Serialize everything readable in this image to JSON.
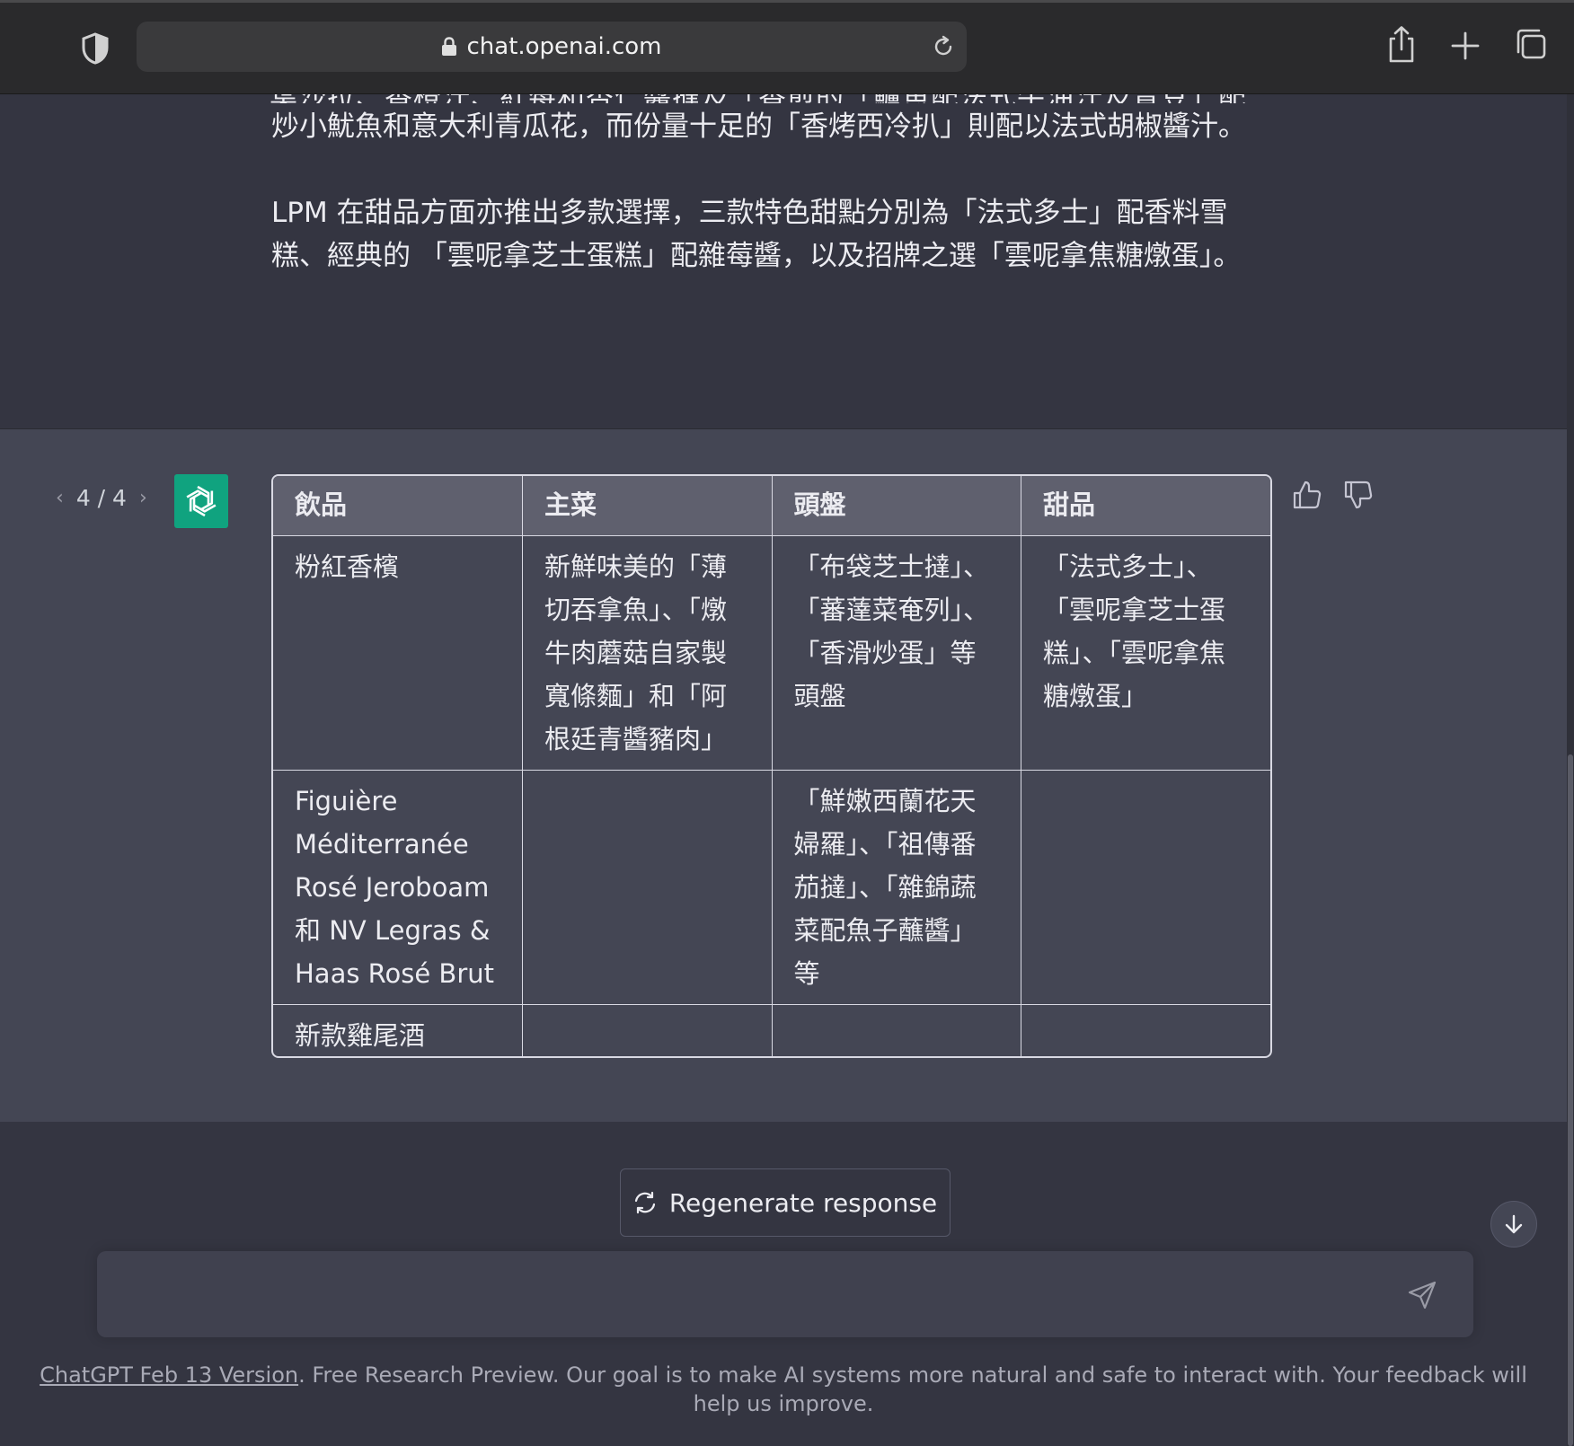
{
  "browser": {
    "url": "chat.openai.com"
  },
  "user_message": {
    "cut_line": "葉沙拉、香橙汁、紅莓和杏仁醬撻及「香煎的「鱸魚配法式牛油汁及青豆」配香蒜",
    "paragraphs": [
      "炒小魷魚和意大利青瓜花，而份量十足的「香烤西冷扒」則配以法式胡椒醬汁。",
      "LPM 在甜品方面亦推出多款選擇，三款特色甜點分別為「法式多士」配香料雪糕、經典的 「雲呢拿芝士蛋糕」配雜莓醬，以及招牌之選「雲呢拿焦糖燉蛋」。"
    ]
  },
  "assistant_message": {
    "pager": "4 / 4",
    "table": {
      "headers": [
        "飲品",
        "主菜",
        "頭盤",
        "甜品"
      ],
      "rows": [
        [
          "粉紅香檳",
          "新鮮味美的「薄切吞拿魚」、「燉牛肉蘑菇自家製寬條麵」和「阿根廷青醬豬肉」",
          "「布袋芝士撻」、「蕃薘菜奄列」、「香滑炒蛋」等頭盤",
          "「法式多士」、「雲呢拿芝士蛋糕」、「雲呢拿焦糖燉蛋」"
        ],
        [
          "Figuière Méditerranée Rosé Jeroboam 和 NV Legras & Haas Rosé Brut",
          "",
          "「鮮嫩西蘭花天婦羅」、「祖傳番茄撻」、「雜錦蔬菜配魚子蘸醬」等",
          ""
        ],
        [
          "新款雞尾酒",
          "",
          "",
          ""
        ]
      ]
    }
  },
  "composer": {
    "regenerate_label": "Regenerate response",
    "input_value": "",
    "input_placeholder": ""
  },
  "footer": {
    "version_link": "ChatGPT Feb 13 Version",
    "text": ". Free Research Preview. Our goal is to make AI systems more natural and safe to interact with. Your feedback will help us improve."
  },
  "colors": {
    "background": "#343541",
    "assistant_bg": "#444654",
    "avatar": "#10a37f",
    "table_header": "#5f606e"
  }
}
